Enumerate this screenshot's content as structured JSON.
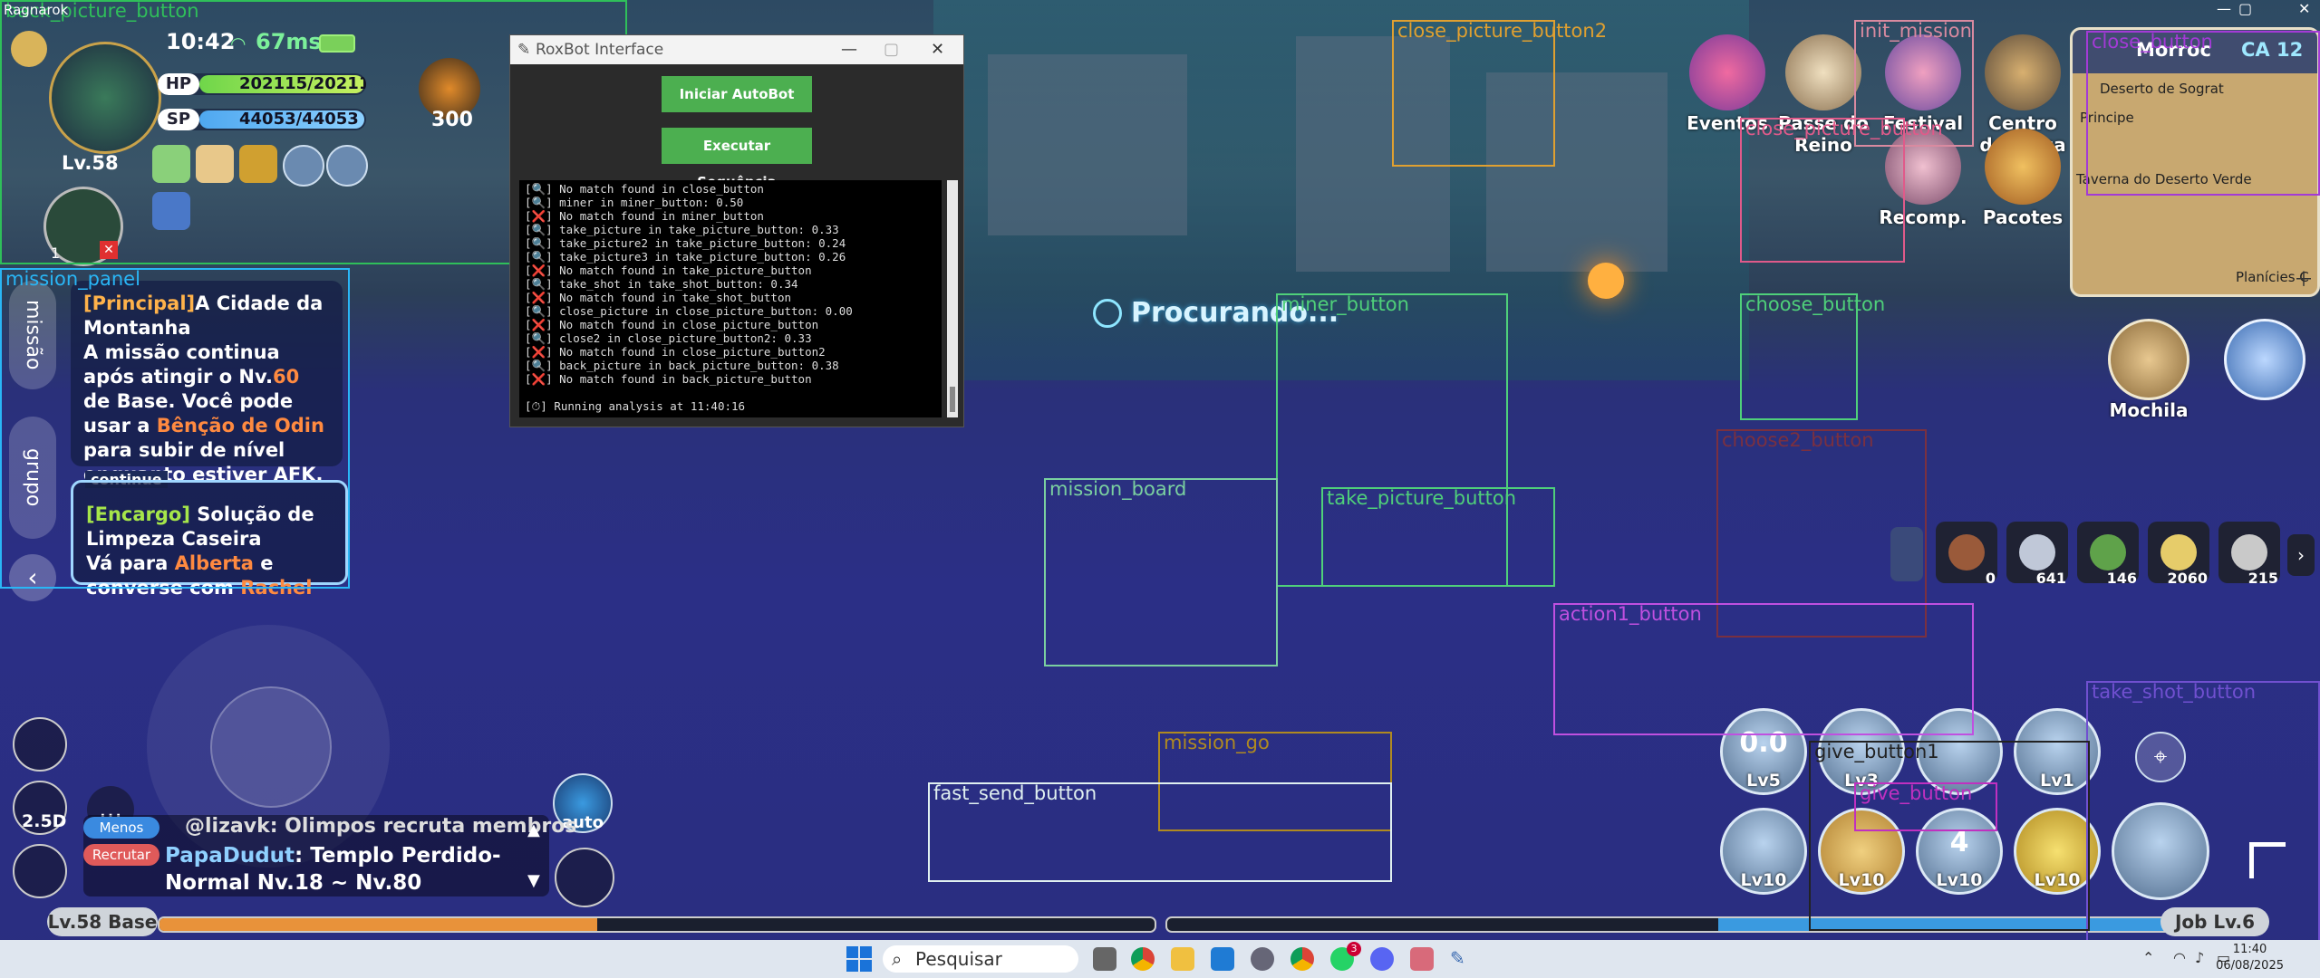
{
  "window": {
    "title": "Ragnarok"
  },
  "hud": {
    "time": "10:42",
    "ping": "67ms",
    "hp_label": "HP",
    "hp_value": "202115/202115",
    "hp_fraction": 1.0,
    "sp_label": "SP",
    "sp_value": "44053/44053",
    "sp_fraction": 1.0,
    "level": "Lv.58",
    "power": "300",
    "pet_level": "1"
  },
  "mission_panel": {
    "tab_missao": "missão",
    "tab_grupo": "grupo",
    "principal_tag": "[Principal]",
    "principal_title": "A Cidade da Montanha",
    "principal_text_1": "A missão continua após atingir o Nv.",
    "principal_level": "60",
    "principal_text_2": " de Base. Você pode usar a ",
    "principal_item": "Bênção de Odin",
    "principal_text_3": " para subir de nível enquanto estiver AFK.",
    "continue_label": "continue",
    "encargo_tag": "[Encargo]",
    "encargo_title": " Solução de Limpeza Caseira",
    "encargo_text_1": "Vá para ",
    "encargo_npc": "Alberta",
    "encargo_text_2": " e converse com ",
    "encargo_npc2": "Rachel"
  },
  "center": {
    "searching": "Procurando..."
  },
  "top_icons": [
    {
      "label": "Eventos"
    },
    {
      "label": "Passe do Reino"
    },
    {
      "label": "Festival"
    },
    {
      "label": "Centro de Troca"
    }
  ],
  "second_icons": [
    {
      "label": "Recomp."
    },
    {
      "label": "Pacotes"
    }
  ],
  "minimap": {
    "region": "Morroc",
    "ca": "CA 12",
    "area_1": "Deserto de Sograt",
    "area_2": "Principe",
    "area_3": "Taverna do Deserto Verde",
    "area_4": "Planícies C"
  },
  "bag": {
    "label": "Mochila"
  },
  "items": [
    {
      "count": "0",
      "color": "#9a5a3a"
    },
    {
      "count": "641",
      "color": "#c0c8d8"
    },
    {
      "count": "146",
      "color": "#5fa24a"
    },
    {
      "count": "2060",
      "color": "#e6cc6a"
    },
    {
      "count": "215",
      "color": "#c9c9c9"
    }
  ],
  "skills": [
    {
      "value": "0.0",
      "level": "Lv5"
    },
    {
      "value": "",
      "level": "Lv3"
    },
    {
      "value": "",
      "level": ""
    },
    {
      "value": "",
      "level": "Lv1"
    },
    {
      "value": "",
      "level": "Lv10"
    },
    {
      "value": "",
      "level": "Lv10"
    },
    {
      "value": "4",
      "level": "Lv10"
    },
    {
      "value": "",
      "level": "Lv10"
    }
  ],
  "left_controls": {
    "view_label": "2.5D",
    "auto_label": "auto"
  },
  "chat": {
    "badge_1": "Menos",
    "msg_1": "@lizavk: Olimpos recruta membros",
    "badge_2": "Recrutar",
    "msg_2_name": "PapaDudut",
    "msg_2_text": ": Templo Perdido-Normal Nv.18 ~ Nv.80"
  },
  "bottom": {
    "base_level": "Lv.58 Base",
    "job_level": "Job Lv.6",
    "base_xp_fraction": 0.44,
    "job_xp_fraction": 0.45
  },
  "roxbot": {
    "title": "RoxBot Interface",
    "start_button": "Iniciar AutoBot",
    "sequence_button": "Executar Sequência",
    "log": [
      "[🔍] No match found in close_button",
      "[🔍] miner in miner_button: 0.50",
      "[❌] No match found in miner_button",
      "[🔍] take_picture in take_picture_button: 0.33",
      "[🔍] take_picture2 in take_picture_button: 0.24",
      "[🔍] take_picture3 in take_picture_button: 0.26",
      "[❌] No match found in take_picture_button",
      "[🔍] take_shot in take_shot_button: 0.34",
      "[❌] No match found in take_shot_button",
      "[🔍] close_picture in close_picture_button: 0.00",
      "[❌] No match found in close_picture_button",
      "[🔍] close2 in close_picture_button2: 0.33",
      "[❌] No match found in close_picture_button2",
      "[🔍] back_picture in back_picture_button: 0.38",
      "[❌] No match found in back_picture_button",
      "",
      "[⏱] Running analysis at 11:40:16"
    ]
  },
  "overlays": [
    {
      "label": "back_picture_button",
      "color": "#2fbf5a"
    },
    {
      "label": "mission_panel",
      "color": "#29b6f6"
    },
    {
      "label": "close_picture_button2",
      "color": "#e0a030"
    },
    {
      "label": "init_mission",
      "color": "#d98aa0"
    },
    {
      "label": "close_button",
      "color": "#a33ad6"
    },
    {
      "label": "close_picture_button",
      "color": "#e05a8a"
    },
    {
      "label": "miner_button",
      "color": "#4fd07a"
    },
    {
      "label": "choose_button",
      "color": "#4fd07a"
    },
    {
      "label": "choose2_button",
      "color": "#7a3040"
    },
    {
      "label": "mission_board",
      "color": "#7ad0a0"
    },
    {
      "label": "take_picture_button",
      "color": "#4fd07a"
    },
    {
      "label": "action1_button",
      "color": "#c050e0"
    },
    {
      "label": "take_shot_button",
      "color": "#7050d0"
    },
    {
      "label": "mission_go",
      "color": "#b08a20"
    },
    {
      "label": "fast_send_button",
      "color": "#e0f0f0"
    },
    {
      "label": "give_button1",
      "color": "#222222"
    },
    {
      "label": "give_button",
      "color": "#c030c0"
    }
  ],
  "taskbar": {
    "search_placeholder": "Pesquisar",
    "time": "11:40",
    "date": "06/08/2025",
    "badge": "3"
  }
}
